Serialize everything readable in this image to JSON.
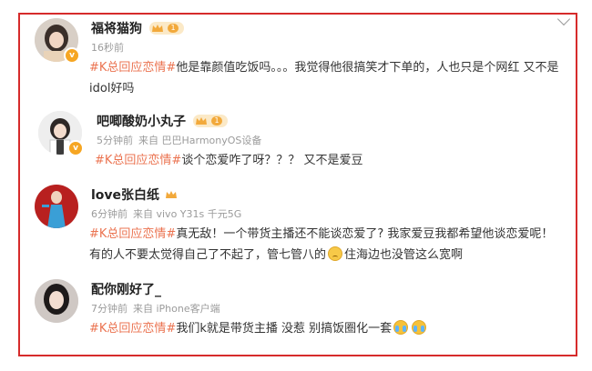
{
  "comments": [
    {
      "username": "福将猫狗",
      "level": "1",
      "time": "16秒前",
      "source": "",
      "tag": "#K总回应恋情#",
      "text": "他是靠颜值吃饭吗。。。我觉得他很搞笑才下单的，人也只是个网红 又不是idol好吗"
    },
    {
      "username": "吧唧酸奶小丸子",
      "level": "1",
      "time": "5分钟前",
      "source": "来自 巴巴HarmonyOS设备",
      "tag": "#K总回应恋情#",
      "text": "谈个恋爱咋了呀？？？ 又不是爱豆"
    },
    {
      "username": "love张白纸",
      "level": "",
      "time": "6分钟前",
      "source": "来自 vivo Y31s 千元5G",
      "tag": "#K总回应恋情#",
      "text": "真无敌！一个带货主播还不能谈恋爱了? 我家爱豆我都希望他谈恋爱呢！有的人不要太觉得自己了不起了，管七管八的",
      "text_after_emoji": "住海边也没管这么宽啊"
    },
    {
      "username": "配你刚好了_",
      "level": "",
      "time": "7分钟前",
      "source": "来自 iPhone客户端",
      "tag": "#K总回应恋情#",
      "text": "我们k就是带货主播 没惹 别搞饭圈化一套"
    }
  ],
  "icons": {
    "more": "chevron-down-icon",
    "level_badge": "crown-icon",
    "verified": "verified-badge-icon",
    "emoji_doubt": "doubt-emoji-icon",
    "emoji_cry": "cry-emoji-icon"
  },
  "colors": {
    "tag": "#eb7350",
    "frame": "#d62b2b",
    "meta": "#9b9b9b",
    "badge": "#f6a623"
  }
}
